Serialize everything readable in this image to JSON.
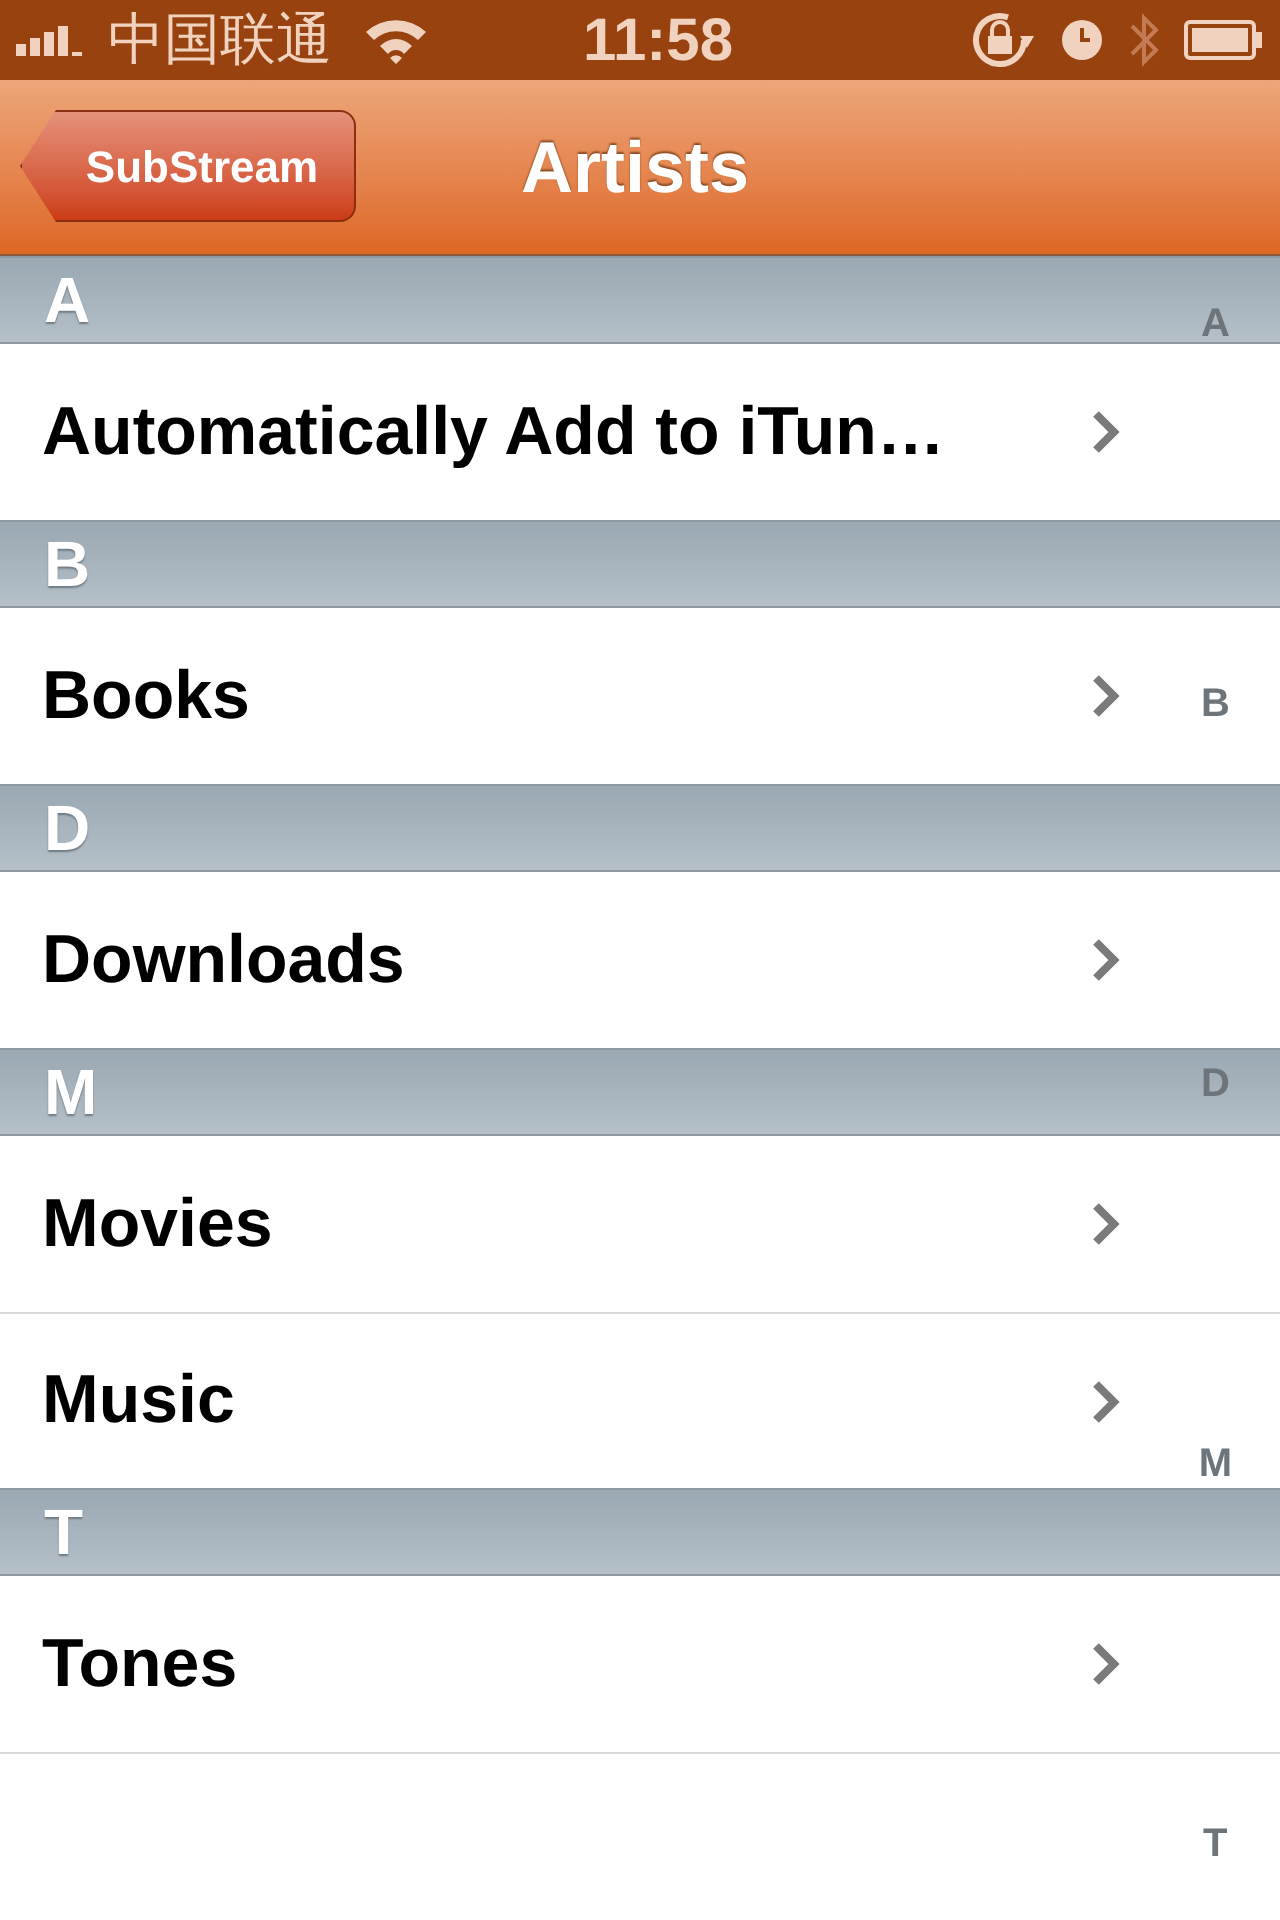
{
  "status_bar": {
    "carrier": "中国联通",
    "time": "11:58"
  },
  "nav_bar": {
    "back_button": "SubStream",
    "title": "Artists"
  },
  "sections": [
    {
      "letter": "A",
      "items": [
        "Automatically Add to iTun…"
      ]
    },
    {
      "letter": "B",
      "items": [
        "Books"
      ]
    },
    {
      "letter": "D",
      "items": [
        "Downloads"
      ]
    },
    {
      "letter": "M",
      "items": [
        "Movies",
        "Music"
      ]
    },
    {
      "letter": "T",
      "items": [
        "Tones"
      ]
    }
  ],
  "section_index": [
    "A",
    "B",
    "D",
    "M",
    "T"
  ]
}
